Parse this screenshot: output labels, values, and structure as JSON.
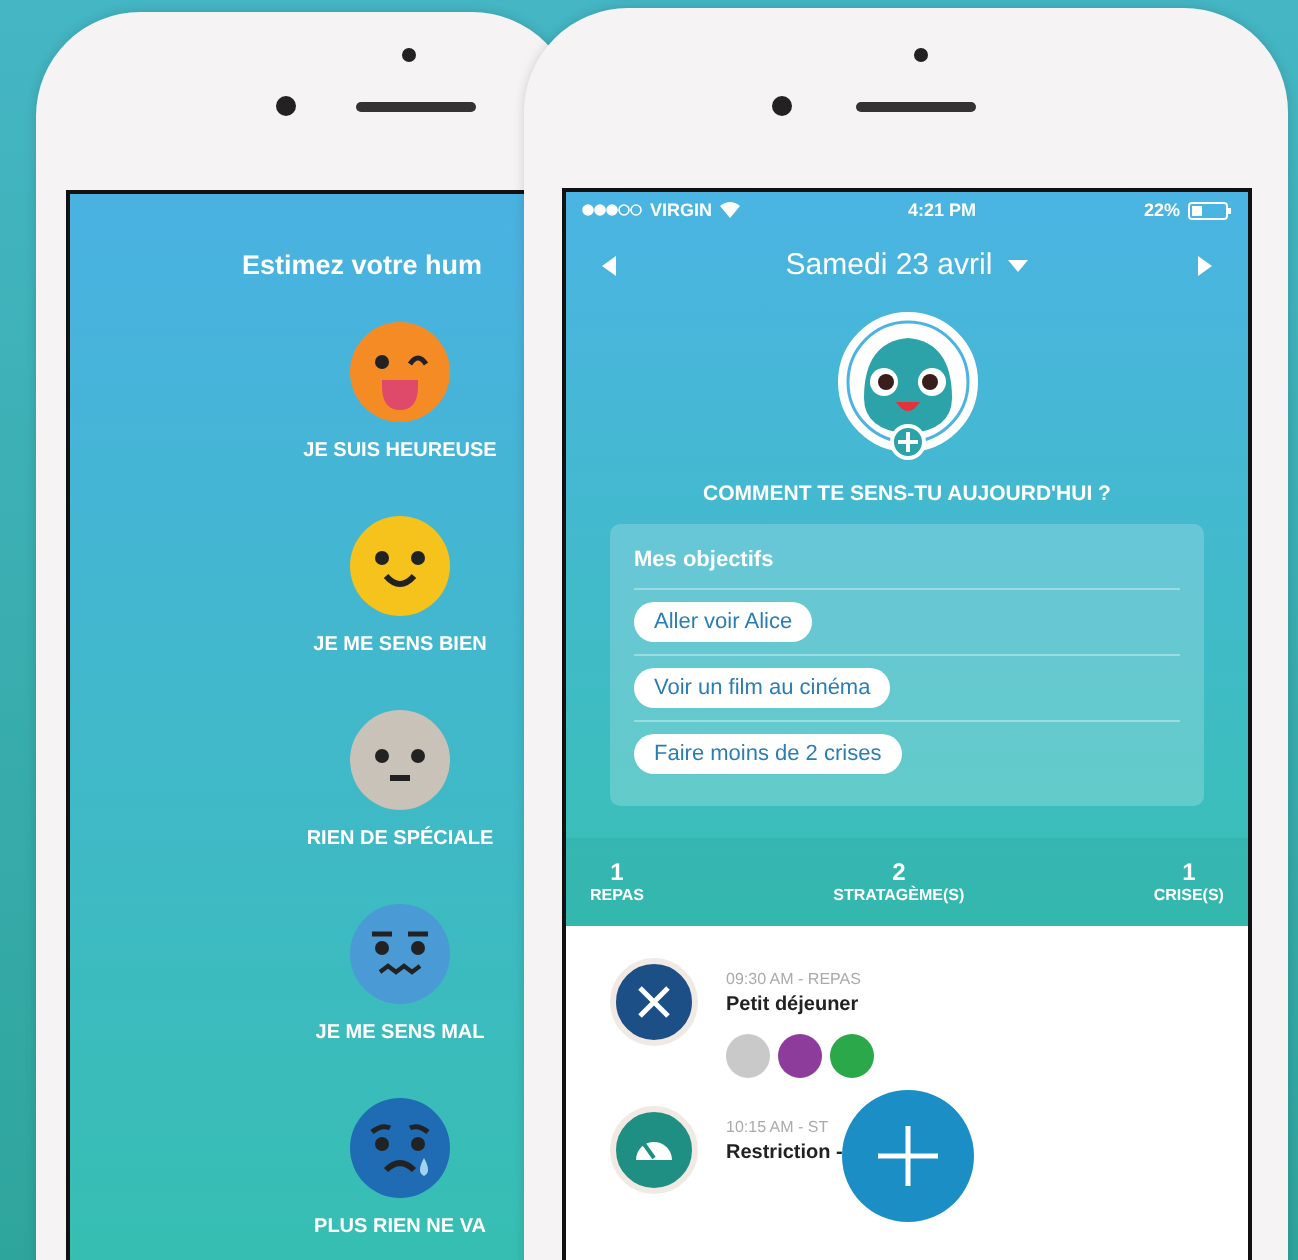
{
  "mood_screen": {
    "title": "Estimez votre hum",
    "moods": [
      {
        "kind": "wink",
        "label": "JE SUIS HEUREUSE"
      },
      {
        "kind": "smile",
        "label": "JE ME SENS BIEN"
      },
      {
        "kind": "neutral",
        "label": "RIEN DE SPÉCIALE"
      },
      {
        "kind": "worried",
        "label": "JE ME SENS MAL"
      },
      {
        "kind": "sad",
        "label": "PLUS RIEN NE VA"
      }
    ]
  },
  "day_screen": {
    "status_bar": {
      "carrier": "VIRGIN",
      "time": "4:21 PM",
      "battery": "22%"
    },
    "header": {
      "date": "Samedi 23 avril"
    },
    "question": "COMMENT TE SENS-TU AUJOURD'HUI ?",
    "goals": {
      "title": "Mes objectifs",
      "items": [
        "Aller voir Alice",
        "Voir un film au cinéma",
        "Faire moins de 2 crises"
      ]
    },
    "stats": [
      {
        "value": "1",
        "label": "REPAS"
      },
      {
        "value": "2",
        "label": "STRATAGÈME(S)"
      },
      {
        "value": "1",
        "label": "CRISE(S)"
      }
    ],
    "timeline": [
      {
        "kind": "meal",
        "time": "09:30 AM - REPAS",
        "title": "Petit déjeuner",
        "tags": [
          {
            "color": "#c9c9c9"
          },
          {
            "color": "#8e3c9c"
          },
          {
            "color": "#2aa84a"
          }
        ]
      },
      {
        "kind": "strategy",
        "time": "10:15 AM - ST",
        "title": "Restriction -"
      }
    ]
  }
}
